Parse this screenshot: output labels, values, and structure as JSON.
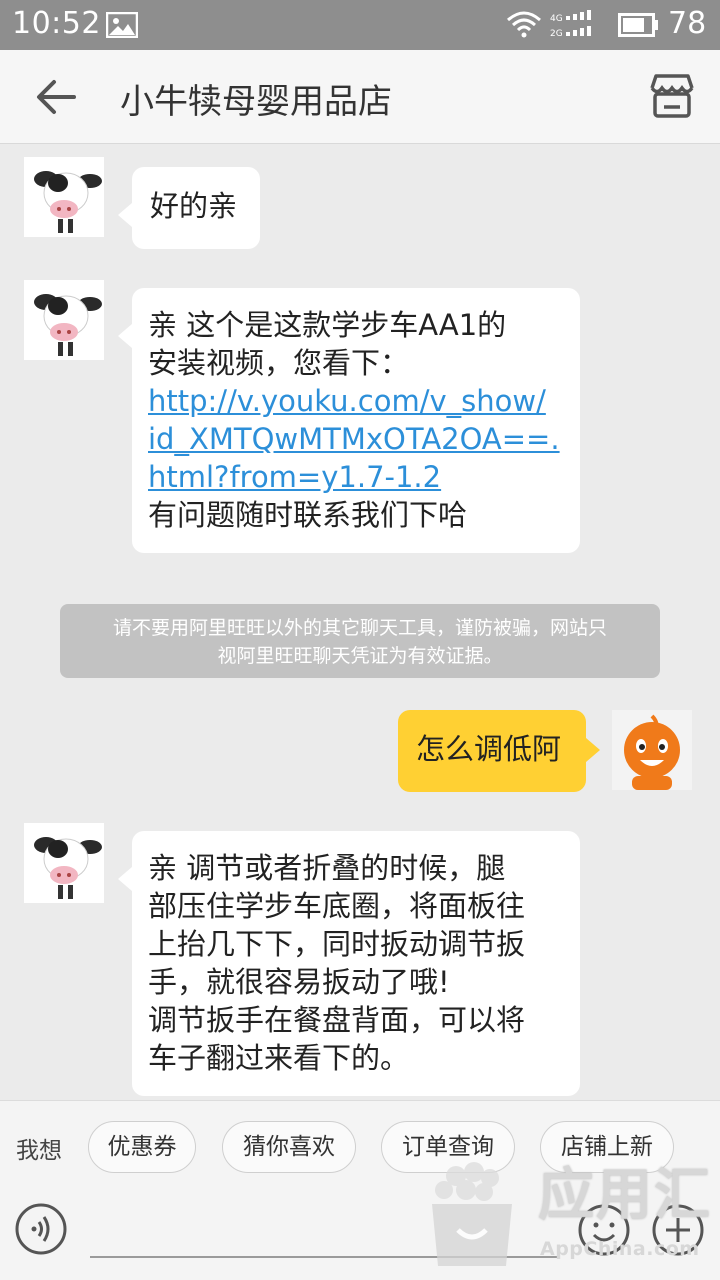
{
  "status_bar": {
    "time": "10:52",
    "battery": "78",
    "icons": [
      "image-icon",
      "wifi-icon",
      "signal-icon",
      "battery-icon"
    ]
  },
  "header": {
    "title": "小牛犊母婴用品店",
    "back_icon": "back-arrow-icon",
    "shop_icon": "shop-icon"
  },
  "messages": [
    {
      "side": "left",
      "lines": [
        "好的亲"
      ]
    },
    {
      "side": "left",
      "lines": [
        "亲 这个是这款学步车AA1的",
        "安装视频，您看下："
      ],
      "link_lines": [
        "http://v.youku.com/v_show/",
        "id_XMTQwMTMxOTA2OA==.",
        "html?from=y1.7-1.2"
      ],
      "after_lines": [
        "有问题随时联系我们下哈"
      ]
    },
    {
      "side": "right",
      "lines": [
        "怎么调低阿"
      ]
    },
    {
      "side": "left",
      "lines": [
        "亲 调节或者折叠的时候，腿",
        "部压住学步车底圈，将面板往",
        "上抬几下下，同时扳动调节扳",
        "手，就很容易扳动了哦!",
        "调节扳手在餐盘背面，可以将",
        "车子翻过来看下的。"
      ]
    }
  ],
  "notice": {
    "line1": "请不要用阿里旺旺以外的其它聊天工具，谨防被骗，网站只",
    "line2": "视阿里旺旺聊天凭证为有效证据。"
  },
  "quickbar": {
    "label": "我想",
    "chips": [
      "优惠券",
      "猜你喜欢",
      "订单查询",
      "店铺上新"
    ]
  },
  "input": {
    "placeholder": "",
    "voice_icon": "voice-icon",
    "emoji_icon": "emoji-icon",
    "plus_icon": "plus-icon"
  },
  "watermark": {
    "text": "应用汇",
    "sub": "AppChina.com"
  },
  "colors": {
    "status_bar": "#8e8e8e",
    "header_bg": "#f6f6f6",
    "chat_bg": "#ebebeb",
    "my_bubble": "#ffd033",
    "link": "#2c8fd9",
    "notice_bg": "#c2c2c2"
  }
}
